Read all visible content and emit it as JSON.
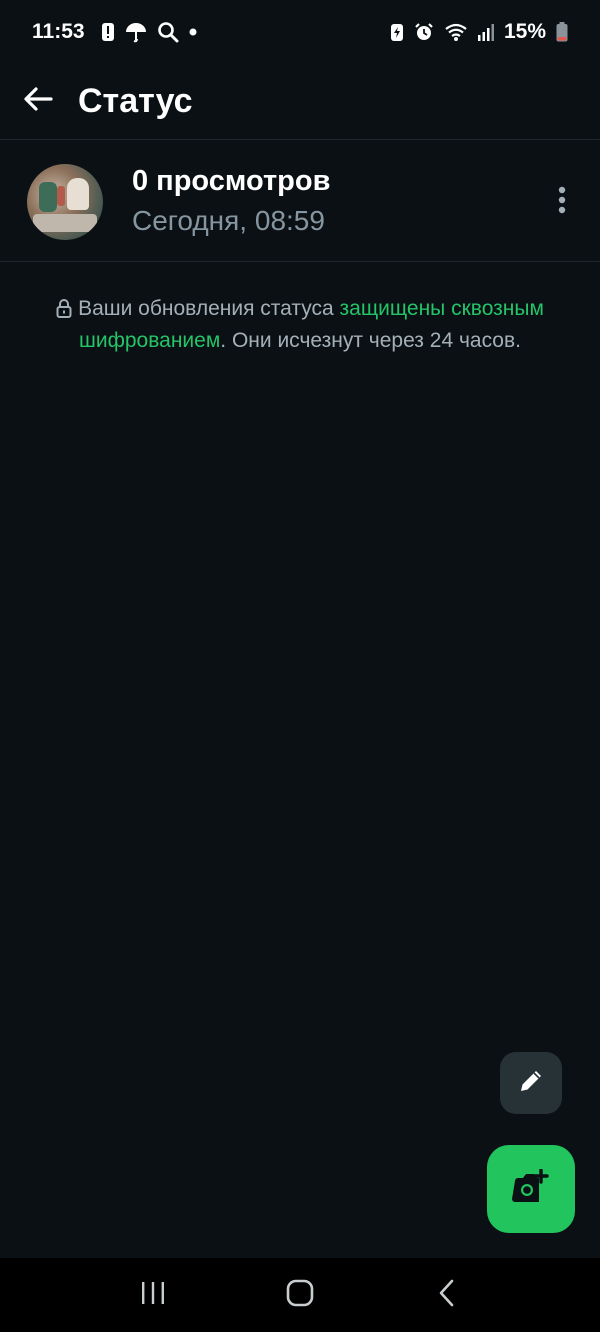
{
  "status_bar": {
    "time": "11:53",
    "battery": "15%",
    "icons_left": [
      "alert-icon",
      "umbrella-icon",
      "search-icon",
      "dot-icon"
    ],
    "icons_right": [
      "battery-saver-icon",
      "alarm-icon",
      "wifi-icon",
      "signal-icon",
      "battery-icon"
    ],
    "battery_low_color": "#e05a4f"
  },
  "app_bar": {
    "title": "Статус",
    "back_icon": "arrow-left-icon"
  },
  "status_item": {
    "views": "0 просмотров",
    "time": "Сегодня, 08:59",
    "more_icon": "more-vertical-icon"
  },
  "notice": {
    "text_before": "Ваши обновления статуса ",
    "link_text": "защищены сквозным шифрованием",
    "text_after": ". Они исчезнут через 24 часов.",
    "link_color": "#24c468"
  },
  "fabs": {
    "edit_icon": "pencil-icon",
    "camera_icon": "camera-add-icon",
    "accent": "#22c45d"
  },
  "nav_bar": {
    "recent_icon": "recent-apps-icon",
    "home_icon": "home-icon",
    "back_icon": "back-chevron-icon"
  }
}
